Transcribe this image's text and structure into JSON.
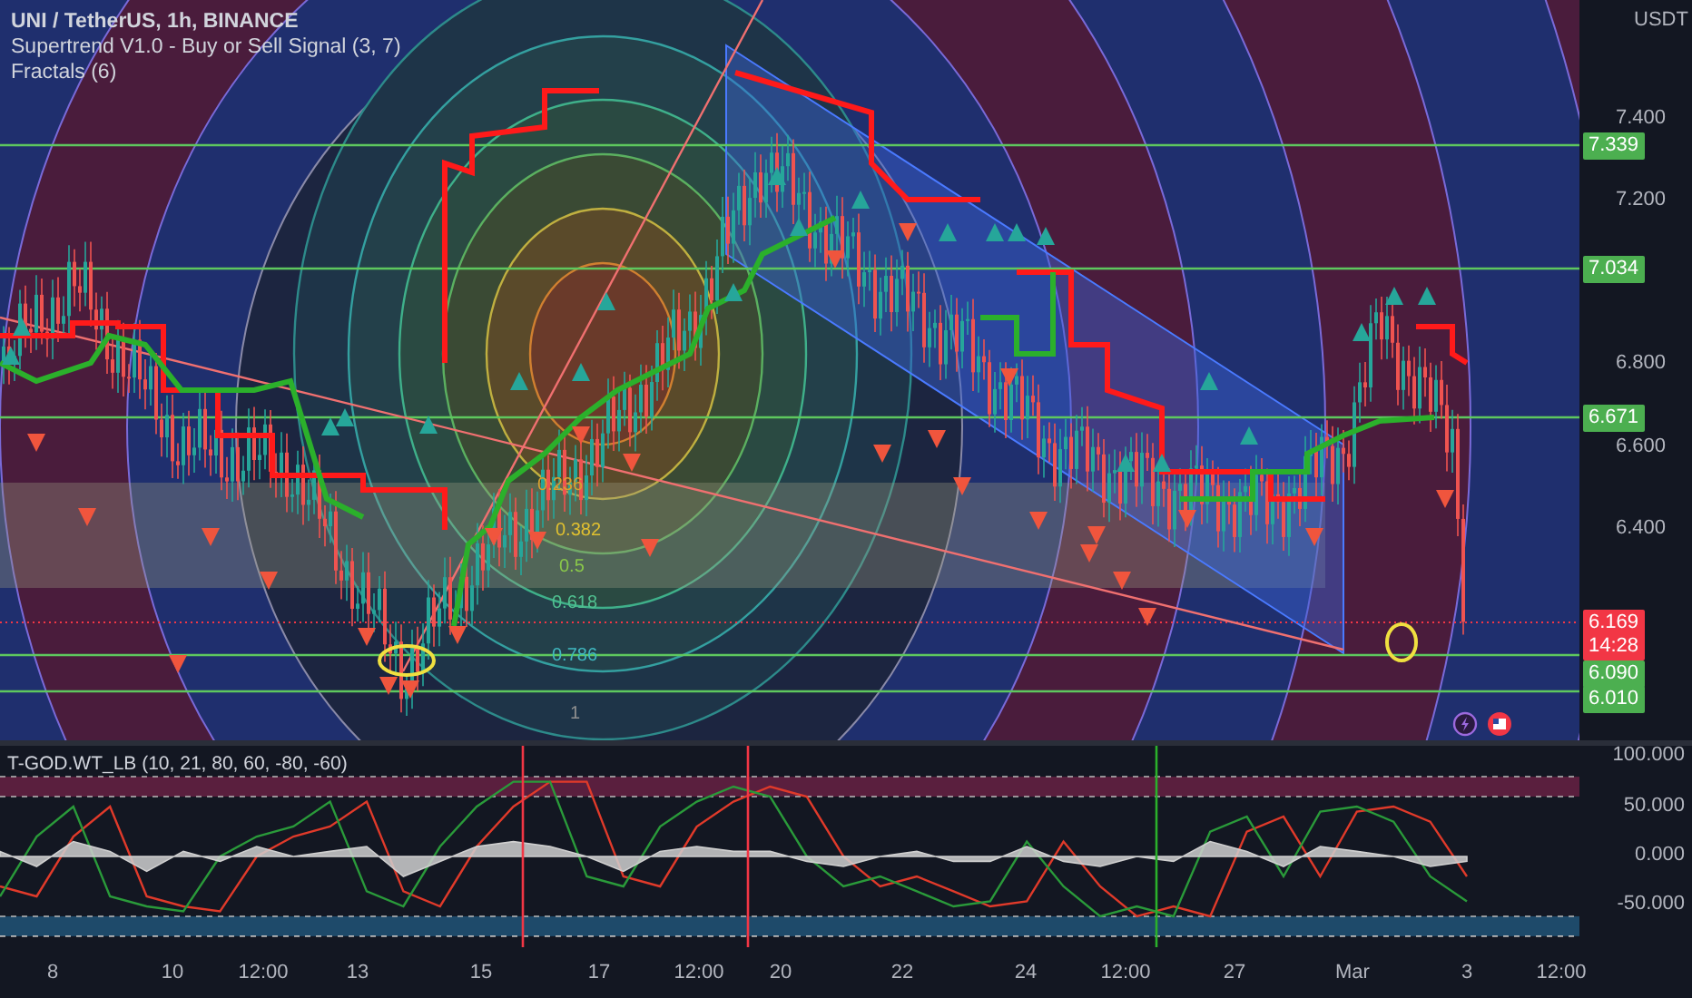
{
  "legend": {
    "symbol": "UNI / TetherUS, 1h, BINANCE",
    "indicators": [
      "Supertrend V1.0 - Buy or Sell Signal (3, 7)",
      "Fractals (6)"
    ]
  },
  "price_axis": {
    "unit": "USDT",
    "ticks": [
      "7.400",
      "7.200",
      "6.800",
      "6.600",
      "6.400"
    ]
  },
  "price_tags": [
    {
      "value": "7.339",
      "color": "#4caf50"
    },
    {
      "value": "7.034",
      "color": "#4caf50"
    },
    {
      "value": "6.671",
      "color": "#4caf50"
    },
    {
      "value": "6.169",
      "countdown": "14:28",
      "color": "#f23645"
    },
    {
      "value": "6.090",
      "color": "#4caf50"
    },
    {
      "value": "6.010",
      "color": "#4caf50"
    }
  ],
  "fib_levels": [
    "0.236",
    "0.382",
    "0.5",
    "0.618",
    "0.786",
    "1"
  ],
  "oscillator": {
    "title": "T-GOD.WT_LB (10, 21, 80, 60, -80, -60)",
    "chart_data": {
      "type": "line",
      "ylim": [
        -91,
        111
      ],
      "yticks": [
        {
          "value": 100,
          "label": "100.000"
        },
        {
          "value": 50,
          "label": "50.000"
        },
        {
          "value": 0,
          "label": "0.000"
        },
        {
          "value": -50,
          "label": "-50.000"
        }
      ],
      "series": [
        {
          "type": "area",
          "color": "#cfcfcf",
          "values": [
            5,
            -10,
            15,
            5,
            -15,
            5,
            -5,
            10,
            0,
            5,
            10,
            -20,
            -5,
            10,
            15,
            10,
            0,
            -15,
            5,
            10,
            5,
            5,
            -5,
            -10,
            0,
            5,
            -5,
            -5,
            10,
            -5,
            -10,
            0,
            -5,
            15,
            5,
            -10,
            10,
            5,
            0,
            -10,
            -5
          ]
        },
        {
          "color": "#e03a2a",
          "values": [
            -30,
            -40,
            20,
            50,
            -40,
            -50,
            -55,
            0,
            20,
            30,
            55,
            -35,
            -50,
            10,
            50,
            75,
            75,
            -20,
            -30,
            30,
            55,
            70,
            60,
            0,
            -30,
            -20,
            -35,
            -50,
            -45,
            15,
            -30,
            -60,
            -50,
            -60,
            25,
            40,
            -20,
            45,
            50,
            35,
            -20
          ]
        },
        {
          "color": "#2a9a3a",
          "values": [
            -40,
            20,
            50,
            -40,
            -50,
            -55,
            0,
            20,
            30,
            55,
            -35,
            -50,
            10,
            50,
            75,
            75,
            -20,
            -30,
            30,
            55,
            70,
            60,
            0,
            -30,
            -20,
            -35,
            -50,
            -45,
            15,
            -30,
            -60,
            -50,
            -60,
            25,
            40,
            -20,
            45,
            50,
            35,
            -20,
            -45
          ]
        }
      ]
    }
  },
  "time_axis": [
    "8",
    "10",
    "12:00",
    "13",
    "15",
    "17",
    "12:00",
    "20",
    "22",
    "24",
    "12:00",
    "27",
    "Mar",
    "3",
    "12:00"
  ]
}
